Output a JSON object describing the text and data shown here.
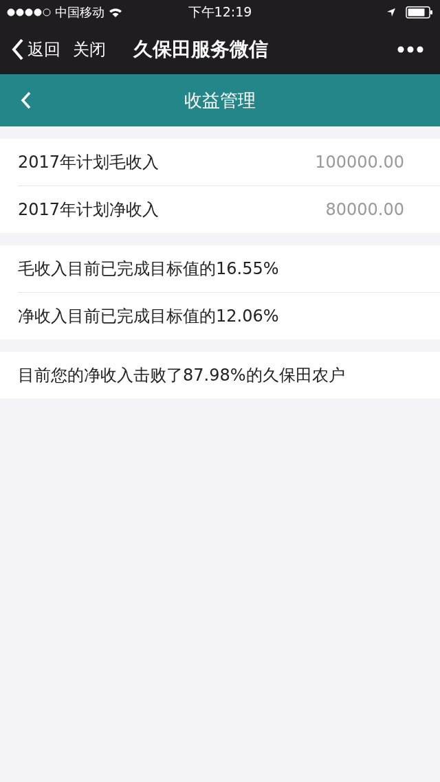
{
  "status_bar": {
    "carrier": "中国移动",
    "time": "下午12:19"
  },
  "nav_bar": {
    "back": "返回",
    "close": "关闭",
    "title": "久保田服务微信"
  },
  "header": {
    "title": "收益管理"
  },
  "groups": [
    {
      "rows": [
        {
          "label": "2017年计划毛收入",
          "value": "100000.00"
        },
        {
          "label": "2017年计划净收入",
          "value": "80000.00"
        }
      ]
    },
    {
      "rows": [
        {
          "label": "毛收入目前已完成目标值的16.55%"
        },
        {
          "label": "净收入目前已完成目标值的12.06%"
        }
      ]
    },
    {
      "rows": [
        {
          "label": "目前您的净收入击败了87.98%的久保田农户"
        }
      ]
    }
  ]
}
